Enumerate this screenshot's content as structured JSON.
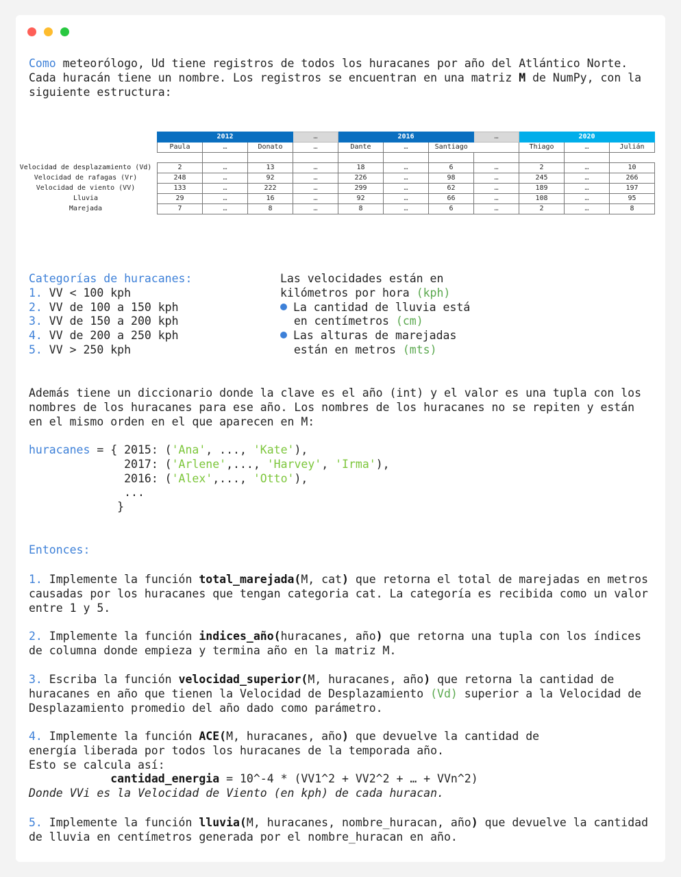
{
  "window": {
    "traffic_lights": [
      "#fe5f57",
      "#febc2e",
      "#28c840"
    ]
  },
  "intro": {
    "l1_a": "Como",
    "l1_b": " meteorólogo, Ud tiene registros de todos los huracanes por año del Atlántico Norte.",
    "l2_a": "Cada huracán tiene un nombre. Los registros se encuentran en una matriz ",
    "l2_m": "M",
    "l2_b": " de NumPy, con la",
    "l3": "siguiente estructura:"
  },
  "table": {
    "years": [
      {
        "label": "2012",
        "span": 3
      },
      {
        "label": "…",
        "span": 1
      },
      {
        "label": "2016",
        "span": 3
      },
      {
        "label": "…",
        "span": 1
      },
      {
        "label": "2020",
        "span": 3
      }
    ],
    "names": [
      "Paula",
      "…",
      "Donato",
      "…",
      "Dante",
      "…",
      "Santiago",
      "",
      "Thiago",
      "…",
      "Julián"
    ],
    "row_labels": [
      "Velocidad de desplazamiento (Vd)",
      "Velocidad de rafagas (Vr)",
      "Velocidad de viento (VV)",
      "Lluvia",
      "Marejada"
    ],
    "rows": [
      [
        "2",
        "…",
        "13",
        "…",
        "18",
        "…",
        "6",
        "…",
        "2",
        "…",
        "10"
      ],
      [
        "248",
        "…",
        "92",
        "…",
        "226",
        "…",
        "98",
        "…",
        "245",
        "…",
        "266"
      ],
      [
        "133",
        "…",
        "222",
        "…",
        "299",
        "…",
        "62",
        "…",
        "189",
        "…",
        "197"
      ],
      [
        "29",
        "…",
        "16",
        "…",
        "92",
        "…",
        "66",
        "…",
        "108",
        "…",
        "95"
      ],
      [
        "7",
        "…",
        "8",
        "…",
        "8",
        "…",
        "6",
        "…",
        "2",
        "…",
        "8"
      ]
    ]
  },
  "categories": {
    "title": "Categorías de huracanes:",
    "items": [
      {
        "n": "1.",
        "t": " VV < 100 kph"
      },
      {
        "n": "2.",
        "t": " VV de 100 a 150 kph"
      },
      {
        "n": "3.",
        "t": " VV de 150 a 200 kph"
      },
      {
        "n": "4.",
        "t": " VV de 200 a 250 kph"
      },
      {
        "n": "5.",
        "t": " VV > 250 kph"
      }
    ]
  },
  "units": {
    "l1": "Las velocidades están en",
    "l2": "kilómetros por hora ",
    "l2u": "(kph)",
    "l3": "La cantidad de lluvia está",
    "l4": "en centímetros ",
    "l4u": "(cm)",
    "l5": "Las alturas de marejadas",
    "l6": "están en metros ",
    "l6u": "(mts)"
  },
  "dict_text": [
    "Además tiene un diccionario donde la clave es el año (int) y el valor es una tupla con los",
    "nombres de los huracanes para ese año. Los nombres de los huracanes no se repiten y están",
    "en el mismo orden en el que aparecen en M:"
  ],
  "code": {
    "var": "huracanes",
    "eq": " = { ",
    "y1": "2015: (",
    "s1a": "'Ana'",
    "m1": ", ..., ",
    "s1b": "'Kate'",
    "e1": "),",
    "y2": "2017: (",
    "s2a": "'Arlene'",
    "m2": ",..., ",
    "s2b": "'Harvey'",
    "c2": ", ",
    "s2c": "'Irma'",
    "e2": "),",
    "y3": "2016: (",
    "s3a": "'Alex'",
    "m3": ",..., ",
    "s3b": "'Otto'",
    "e3": "),",
    "dots": "...",
    "close": "}"
  },
  "entonces": "Entonces:",
  "tasks": [
    {
      "n": "1.",
      "a": " Implemente la función ",
      "f": "total_marejada(",
      "p": "M, cat",
      "c": ")",
      "b": " que retorna el total de marejadas en metros",
      "l2": "causadas por los huracanes que tengan categoria cat. La categoría es recibida como un valor",
      "l3": "entre 1 y 5."
    },
    {
      "n": "2.",
      "a": " Implemente la función ",
      "f": "indices_año(",
      "p": "huracanes, año",
      "c": ")",
      "b": " que retorna una tupla con los índices",
      "l2": "de columna donde empieza y termina año en la matriz M."
    },
    {
      "n": "3.",
      "a": " Escriba la función ",
      "f": "velocidad_superior(",
      "p": "M, huracanes, año",
      "c": ")",
      "b": " que retorna la cantidad de",
      "l2a": "huracanes en año que tienen la Velocidad de Desplazamiento ",
      "l2u": "(Vd)",
      "l2b": " superior a la Velocidad de",
      "l3": "Desplazamiento promedio del año dado como parámetro."
    },
    {
      "n": "4.",
      "a": " Implemente la función ",
      "f": "ACE(",
      "p": "M, huracanes, año",
      "c": ")",
      "b": " que devuelve la cantidad de",
      "l2": "energía liberada por todos los huracanes de la temporada año.",
      "l3": "Esto se calcula así:",
      "fv": "cantidad_energia",
      "fe": " = 10^-4 * (VV1^2 + VV2^2 + … + VVn^2)",
      "l5": "Donde VVi es la Velocidad de Viento (en kph) de cada huracan."
    },
    {
      "n": "5.",
      "a": " Implemente la función ",
      "f": "lluvia(",
      "p": "M, huracanes, nombre_huracan, año",
      "c": ")",
      "b": " que devuelve la cantidad",
      "l2": "de lluvia en centímetros generada por el nombre_huracan en año."
    }
  ]
}
